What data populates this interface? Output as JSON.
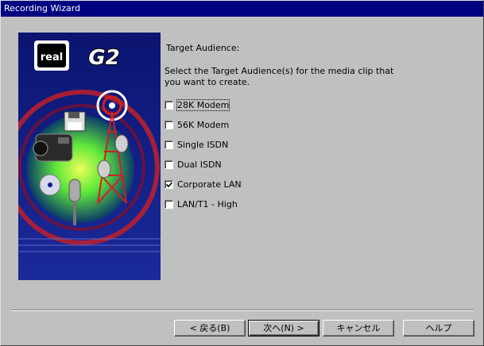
{
  "window": {
    "title": "Recording Wizard"
  },
  "banner": {
    "logo_text": "real",
    "product_text": "G2"
  },
  "content": {
    "heading": "Target Audience:",
    "instructions": "Select the Target Audience(s) for the media clip that you want to create.",
    "options": [
      {
        "label": "28K Modem",
        "checked": false,
        "focused": true
      },
      {
        "label": "56K Modem",
        "checked": false,
        "focused": false
      },
      {
        "label": "Single ISDN",
        "checked": false,
        "focused": false
      },
      {
        "label": "Dual ISDN",
        "checked": false,
        "focused": false
      },
      {
        "label": "Corporate LAN",
        "checked": true,
        "focused": false
      },
      {
        "label": "LAN/T1 - High",
        "checked": false,
        "focused": false
      }
    ]
  },
  "buttons": {
    "back": "< 戻る(B)",
    "next": "次へ(N) >",
    "cancel": "キャンセル",
    "help": "ヘルプ"
  }
}
